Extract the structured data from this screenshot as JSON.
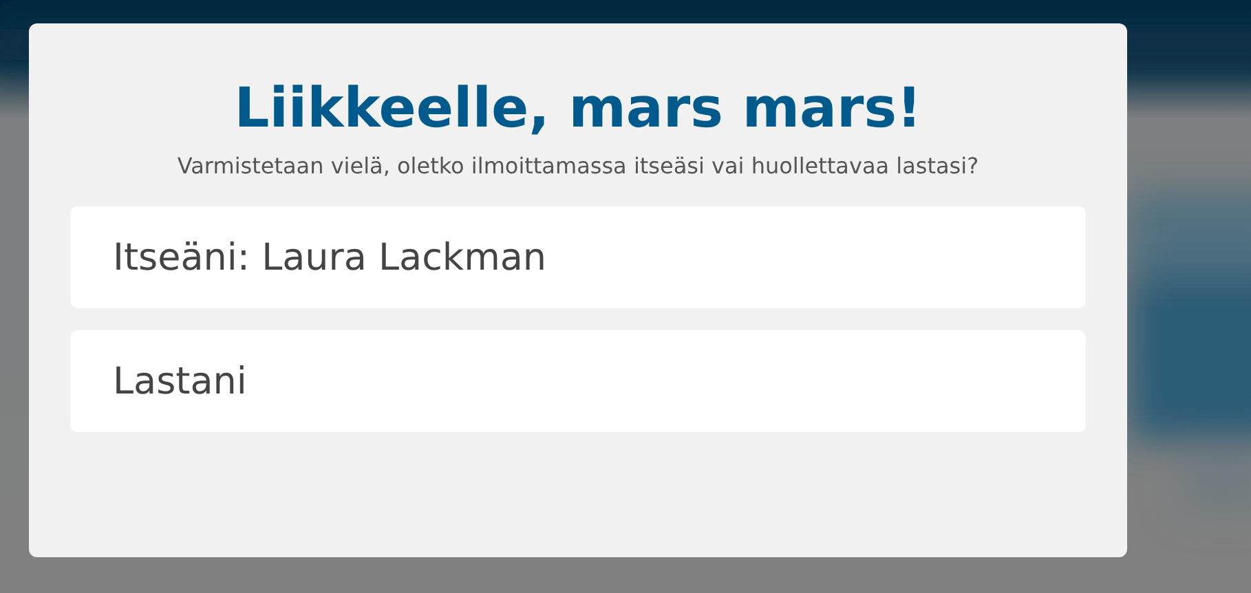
{
  "title": "Liikkeelle, mars mars!",
  "subtitle": "Varmistetaan vielä, oletko ilmoittamassa itseäsi vai huollettavaa lastasi?",
  "options": [
    {
      "label": "Itseäni: Laura Lackman"
    },
    {
      "label": "Lastani"
    }
  ]
}
